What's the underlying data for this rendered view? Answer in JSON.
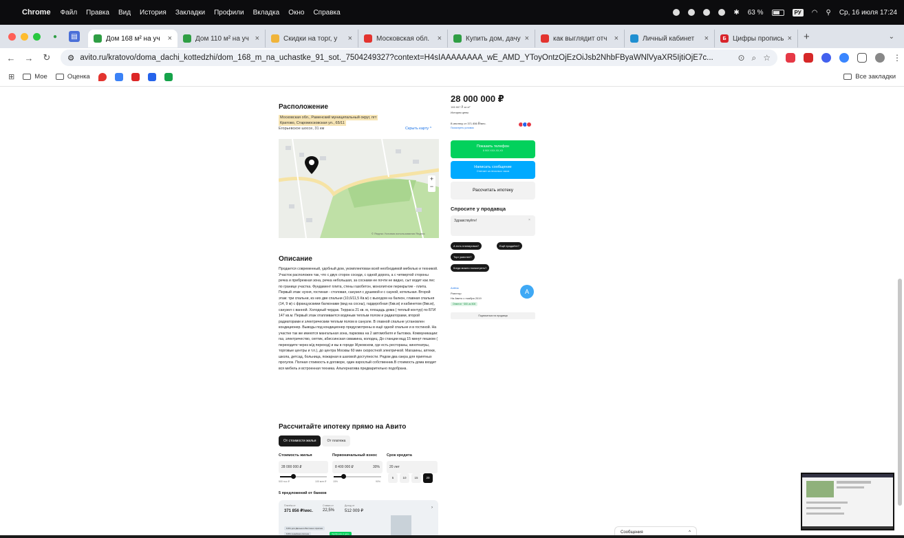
{
  "menubar": {
    "app": "Chrome",
    "items": [
      "Файл",
      "Правка",
      "Вид",
      "История",
      "Закладки",
      "Профили",
      "Вкладка",
      "Окно",
      "Справка"
    ],
    "battery": "63 %",
    "lang": "РУ",
    "datetime": "Ср, 16 июля 17:24"
  },
  "tabs": [
    {
      "title": "Дом 168 м² на уч",
      "active": true
    },
    {
      "title": "Дом 110 м² на уч",
      "active": false
    },
    {
      "title": "Скидки на торг, у",
      "active": false
    },
    {
      "title": "Московская обл.",
      "active": false
    },
    {
      "title": "Купить дом, дачу",
      "active": false
    },
    {
      "title": "как выглядит отч",
      "active": false
    },
    {
      "title": "Личный кабинет",
      "active": false
    },
    {
      "title": "Цифры прописью",
      "active": false
    }
  ],
  "address": {
    "url": "avito.ru/kratovo/doma_dachi_kottedzhi/dom_168_m_na_uchastke_91_sot._7504249327?context=H4sIAAAAAAAA_wE_AMD_YToyOntzOjEzOiJsb2NhbFByaWNlVyaXR5IjtiOjE7c..."
  },
  "bookmarks": {
    "items": [
      "Мое",
      "Оценка"
    ],
    "right": "Все закладки"
  },
  "location": {
    "heading": "Расположение",
    "address_line1": "Московская обл., Раменский муниципальный округ, пгт",
    "address_line2": "Кратово, Старомосковская ул., 65/11",
    "road": "Егорьевское шоссе, 31 км",
    "show_map": "Скрыть карту ^",
    "map_footer": "© Яндекс  Условия использования  Яндекс"
  },
  "description": {
    "heading": "Описание",
    "text": "Продается современный, удобный дом, укомплектован всей необходимой мебелью и техникой. Участок расположен так, что с двух сторон соседи, с одной дорога, а с четвертой стороны речка и прибрежная зона, речка небольшая, за соснами ее почти не видно, сыт водит как лес по границе участка. Фундамент плита, стены газобетон, монолитное перекрытие - плита. Первый этаж: кухня, гостиная - столовая, санузел с душевой и с сауной, котельная. Второй этаж: три спальни, из них две спальни (10,6/11,5 Кв.м) с выходом на балкон, главная спальня (14, 9 м) с французскими балконами (вид на сосны), гардеробная (6кв.м) и кабинетом (8кв.м), санузел с ванной. Холодный чердак. Терраса 21 кв. м, площадь дома ( теплый контур) по БТИ 147 кв.м. Первый этаж отапливается водяным теплым полом и радиаторами, второй радиаторами и электрическим теплым полом в санузле. В главной спальне установлен кондиционер. Выводы под кондиционер предусмотрены в ещё одной спальне и в гостиной. На участке так же имеются мангальная зона, парковка на 2 автомобиля и бытовка. Коммуникации: газ, электричество, септик, абиссинская скважина, колодец. До станции мцд 15 минут пешком ( переходите через ж/д переход) и вы в городе Жуковском, где есть рестораны, кинотеатры, торговые центры и т.п.), до центра Москвы 60 мин скоростной электричкой. Магазины, аптеки, школа, детсад, больница, пожарная в шаговой доступности. Рядом два озера для приятных прогулок. Полная стоимость в договоре, один взрослый собственник.В стоимость дома входит вся мебель и встроенная техника. Альтернатива предварительно подобрана."
  },
  "mortgage": {
    "heading": "Рассчитайте ипотеку прямо на Авито",
    "tab_active": "От стоимости жилья",
    "tab_inactive": "От платежа",
    "cost_label": "Стоимость жилья",
    "cost_value": "28 000 000 ₽",
    "cost_min": "500 тыс ₽",
    "cost_max": "100 млн ₽",
    "down_label": "Первоначальный взнос",
    "down_value": "8 400 000 ₽",
    "down_pct": "30%",
    "down_min": "15%",
    "down_max": "90%",
    "term_label": "Срок кредита",
    "term_value": "20 лет",
    "terms": [
      "5",
      "10",
      "15",
      "20"
    ],
    "term_selected": "20",
    "cost_fraction": 0.28,
    "down_fraction": 0.2,
    "banks_heading": "5 предложений от банков",
    "pay_label": "Платёж от",
    "pay_value": "371 856 ₽/мес.",
    "rate_label": "Ставка от",
    "rate_value": "22,5%",
    "sum_label": "Доход от",
    "sum_value": "512 009 ₽",
    "tag1": "6,5% для Дальнего Востока и Арктики",
    "tag2": "6,5% семейная ипотека",
    "tag3": "Одобрение в день"
  },
  "sidebar": {
    "price": "28 000 000 ₽",
    "price_per_m": "166 667 ₽ за м²",
    "history": "История цены",
    "mortgage_line": "В ипотеку от 371 856 ₽/мес.",
    "mortgage_link": "Посмотреть условия",
    "call_btn": "Показать телефон",
    "call_sub": "8 9ХХ ХХХ-ХХ-ХХ",
    "msg_btn": "Написать сообщение",
    "msg_sub": "Отвечает за несколько часов",
    "calc_btn": "Рассчитать ипотеку",
    "ask_heading": "Спросите у продавца",
    "ask_placeholder": "Здравствуйте!",
    "chips": [
      "А есть планировка?",
      "Ещё продаёте?",
      "Торг уместен?",
      "Когда можно посмотреть?"
    ],
    "seller_name": "Алёна",
    "seller_role": "Риелтор",
    "seller_since": "На Авито с ноября 2019",
    "seller_badge": "Ответит ~300 из 500",
    "avatar_letter": "A",
    "subscribe": "Подписаться на продавца"
  },
  "messages": {
    "label": "Сообщения",
    "chevron": "^"
  },
  "colors": {
    "green": "#02d15c",
    "blue": "#00aaff",
    "highlight": "#f7e5b5"
  }
}
